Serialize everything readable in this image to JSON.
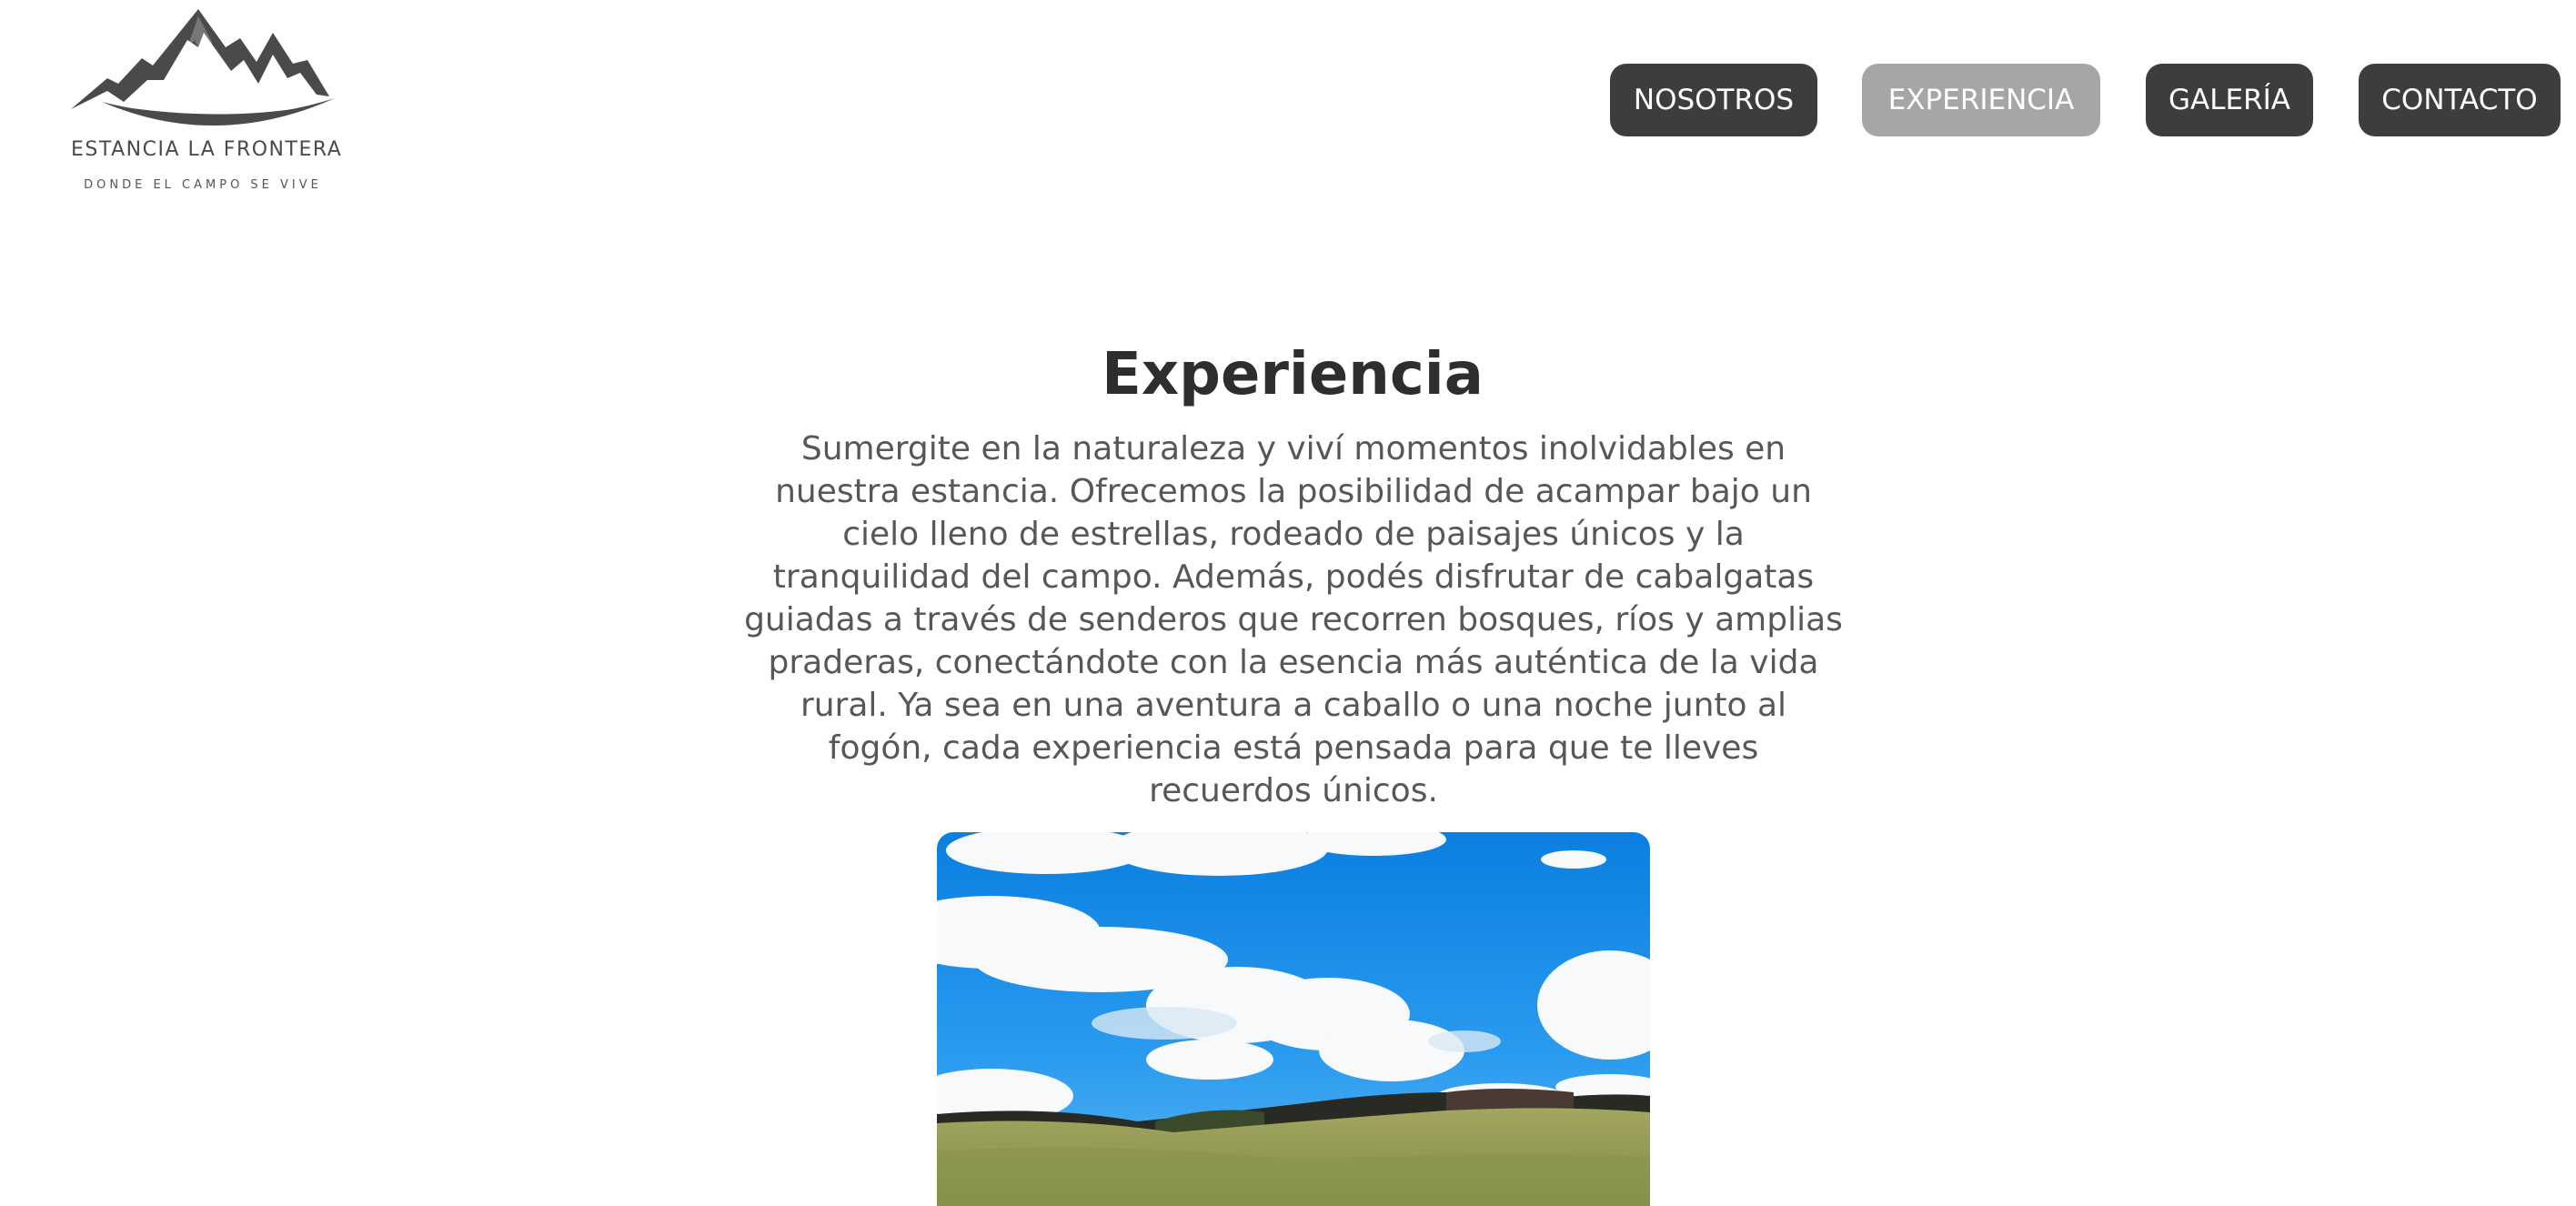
{
  "brand": {
    "name": "ESTANCIA LA FRONTERA",
    "tagline": "DONDE EL CAMPO SE VIVE"
  },
  "nav": {
    "items": [
      {
        "label": "NOSOTROS",
        "active": false
      },
      {
        "label": "EXPERIENCIA",
        "active": true
      },
      {
        "label": "GALERÍA",
        "active": false
      },
      {
        "label": "CONTACTO",
        "active": false
      }
    ]
  },
  "main": {
    "title": "Experiencia",
    "intro": "Sumergite en la naturaleza y viví momentos inolvidables en nuestra estancia. Ofrecemos la posibilidad de acampar bajo un cielo lleno de estrellas, rodeado de paisajes únicos y la tranquilidad del campo. Además, podés disfrutar de cabalgatas guiadas a través de senderos que recorren bosques, ríos y amplias praderas, conectándote con la esencia más auténtica de la vida rural. Ya sea en una aventura a caballo o una noche junto al fogón, cada experiencia está pensada para que te lleves recuerdos únicos."
  },
  "colors": {
    "nav_bg": "#3d3d3d",
    "nav_active_bg": "#a6a6a6",
    "nav_text": "#ffffff",
    "title_text": "#2e2e2e",
    "body_text": "#575757",
    "logo": "#4a4a4a",
    "sky": "#1a8fe6",
    "grass": "#8f9a55"
  },
  "icons": {
    "logo_mark": "mountain-range-icon"
  }
}
